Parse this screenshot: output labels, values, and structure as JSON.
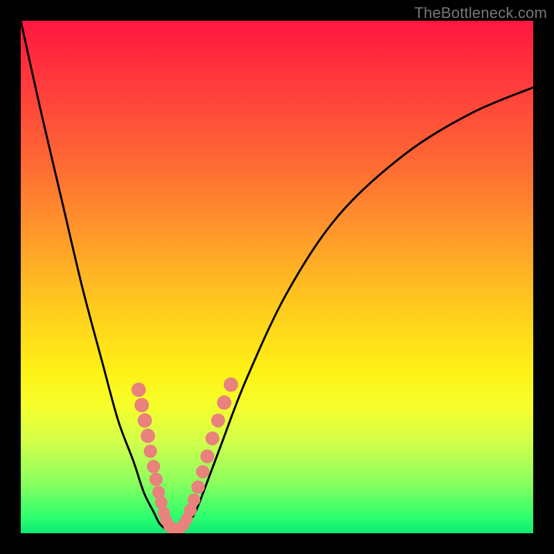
{
  "attribution": "TheBottleneck.com",
  "chart_data": {
    "type": "line",
    "title": "",
    "xlabel": "",
    "ylabel": "",
    "xlim": [
      0,
      100
    ],
    "ylim": [
      0,
      100
    ],
    "grid": false,
    "legend": false,
    "series": [
      {
        "name": "left-curve",
        "x": [
          0,
          4,
          8,
          12,
          16,
          19,
          22,
          24,
          26,
          27,
          28
        ],
        "y": [
          100,
          82,
          65,
          48,
          33,
          22,
          14,
          8,
          4,
          2,
          1
        ]
      },
      {
        "name": "right-curve",
        "x": [
          32,
          34,
          36,
          39,
          44,
          52,
          62,
          75,
          88,
          100
        ],
        "y": [
          1,
          4,
          9,
          17,
          30,
          47,
          62,
          74,
          82,
          87
        ]
      },
      {
        "name": "floor",
        "x": [
          28,
          29,
          30,
          31,
          32
        ],
        "y": [
          1,
          0.6,
          0.5,
          0.6,
          1
        ]
      }
    ],
    "markers": {
      "name": "highlight-dots",
      "color": "#e9817d",
      "points": [
        {
          "x": 23.0,
          "y": 28.0,
          "r": 1.6
        },
        {
          "x": 23.6,
          "y": 25.0,
          "r": 1.6
        },
        {
          "x": 24.2,
          "y": 22.0,
          "r": 1.6
        },
        {
          "x": 24.8,
          "y": 19.0,
          "r": 1.6
        },
        {
          "x": 25.3,
          "y": 16.0,
          "r": 1.4
        },
        {
          "x": 25.9,
          "y": 13.0,
          "r": 1.4
        },
        {
          "x": 26.4,
          "y": 10.5,
          "r": 1.4
        },
        {
          "x": 26.9,
          "y": 8.0,
          "r": 1.3
        },
        {
          "x": 27.4,
          "y": 6.0,
          "r": 1.3
        },
        {
          "x": 27.9,
          "y": 4.0,
          "r": 1.2
        },
        {
          "x": 28.4,
          "y": 2.5,
          "r": 1.2
        },
        {
          "x": 29.0,
          "y": 1.4,
          "r": 1.2
        },
        {
          "x": 29.6,
          "y": 0.9,
          "r": 1.2
        },
        {
          "x": 30.3,
          "y": 0.7,
          "r": 1.2
        },
        {
          "x": 31.0,
          "y": 0.9,
          "r": 1.2
        },
        {
          "x": 31.7,
          "y": 1.6,
          "r": 1.2
        },
        {
          "x": 32.4,
          "y": 2.8,
          "r": 1.2
        },
        {
          "x": 33.1,
          "y": 4.5,
          "r": 1.3
        },
        {
          "x": 33.8,
          "y": 6.5,
          "r": 1.3
        },
        {
          "x": 34.6,
          "y": 9.0,
          "r": 1.4
        },
        {
          "x": 35.5,
          "y": 12.0,
          "r": 1.4
        },
        {
          "x": 36.4,
          "y": 15.0,
          "r": 1.5
        },
        {
          "x": 37.4,
          "y": 18.5,
          "r": 1.5
        },
        {
          "x": 38.5,
          "y": 22.0,
          "r": 1.5
        },
        {
          "x": 39.7,
          "y": 25.5,
          "r": 1.6
        },
        {
          "x": 41.0,
          "y": 29.0,
          "r": 1.6
        }
      ]
    },
    "gradient_stops": [
      {
        "pos": 0.0,
        "color": "#ff163f"
      },
      {
        "pos": 0.28,
        "color": "#ff6a33"
      },
      {
        "pos": 0.55,
        "color": "#ffc81f"
      },
      {
        "pos": 0.75,
        "color": "#f6ff2a"
      },
      {
        "pos": 0.9,
        "color": "#8cff5e"
      },
      {
        "pos": 1.0,
        "color": "#0be874"
      }
    ]
  }
}
